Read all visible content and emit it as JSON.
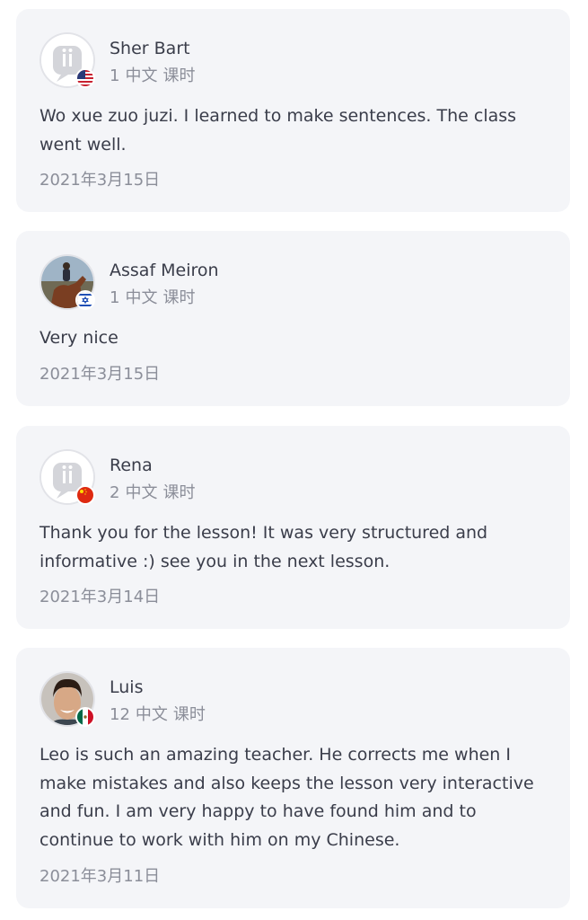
{
  "reviews": [
    {
      "name": "Sher Bart",
      "lessons": "1",
      "lesson_subject": "中文",
      "lesson_unit": "课时",
      "text": "Wo xue zuo juzi.  I learned to make sentences.  The class went well.",
      "date": "2021年3月15日",
      "avatar": "placeholder-logo-avatar",
      "flag": "us-flag-icon"
    },
    {
      "name": "Assaf Meiron",
      "lessons": "1",
      "lesson_subject": "中文",
      "lesson_unit": "课时",
      "text": "Very nice",
      "date": "2021年3月15日",
      "avatar": "photo-avatar-horse-rider",
      "flag": "israel-flag-icon"
    },
    {
      "name": "Rena",
      "lessons": "2",
      "lesson_subject": "中文",
      "lesson_unit": "课时",
      "text": "Thank you for the lesson! It was very structured and informative :) see you in the next lesson.",
      "date": "2021年3月14日",
      "avatar": "placeholder-logo-avatar",
      "flag": "china-flag-icon"
    },
    {
      "name": "Luis",
      "lessons": "12",
      "lesson_subject": "中文",
      "lesson_unit": "课时",
      "text": "Leo is such an amazing teacher. He corrects me when I make mistakes and also keeps the lesson very interactive and fun. I am very happy to have found him and to continue to work with him on my Chinese.",
      "date": "2021年3月11日",
      "avatar": "photo-avatar-smiling-man",
      "flag": "mexico-flag-icon"
    }
  ],
  "colors": {
    "card_bg": "#f4f5f8",
    "text_primary": "#3a3d4a",
    "text_secondary": "#8b8e99"
  }
}
